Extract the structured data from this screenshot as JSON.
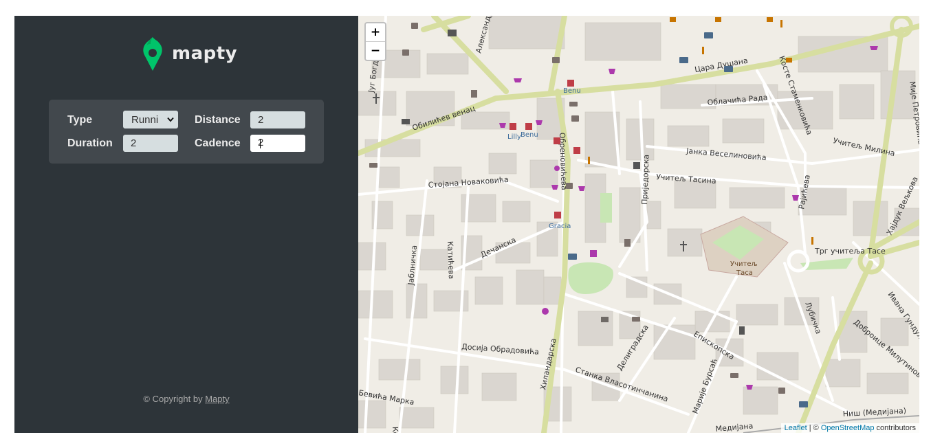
{
  "app": {
    "brand": "mapty",
    "colors": {
      "sidebar_bg": "#2d3439",
      "form_bg": "#42484d",
      "brand_green": "#00c46a",
      "input_bg": "#d6dee0"
    }
  },
  "form": {
    "type_label": "Type",
    "type_value": "Runni",
    "distance_label": "Distance",
    "distance_value": "2",
    "duration_label": "Duration",
    "duration_value": "2",
    "cadence_label": "Cadence",
    "cadence_value": "2"
  },
  "footer": {
    "copyright_prefix": "© Copyright by ",
    "copyright_link": "Mapty"
  },
  "map": {
    "zoom_in": "+",
    "zoom_out": "−",
    "attribution": {
      "leaflet": "Leaflet",
      "separator": " | © ",
      "osm": "OpenStreetMap",
      "suffix": " contributors"
    },
    "streets": [
      "Цара Душана",
      "Облачића Рада",
      "Обилићев венац",
      "Стојана Новаковића",
      "Дечанска",
      "Јанка Веселиновића",
      "Учитељ Тасина",
      "Учитељ Милина",
      "Трг учитеља Тасе",
      "Досија Обрадовића",
      "Станка Власотинчанина",
      "Епископска",
      "Делиградска",
      "Хиландарска",
      "Обреновићева",
      "Приједорска",
      "Рајићева",
      "Јаблничка",
      "Катићева",
      "Косте Стаменковића",
      "Хајдук Вељкова",
      "Доброице Милутиновића",
      "Ивана Гундулића",
      "Лубичка",
      "Марије Бурсаћ",
      "Ниш (Медијана)",
      "Југ Богдана",
      "Александра",
      "Мије Петровића",
      "Бевића Марка",
      "Медијана",
      "Кочића"
    ],
    "pois": [
      "Benu",
      "Lilly",
      "Benu",
      "Gracia",
      "Учитељ",
      "Таса"
    ]
  }
}
